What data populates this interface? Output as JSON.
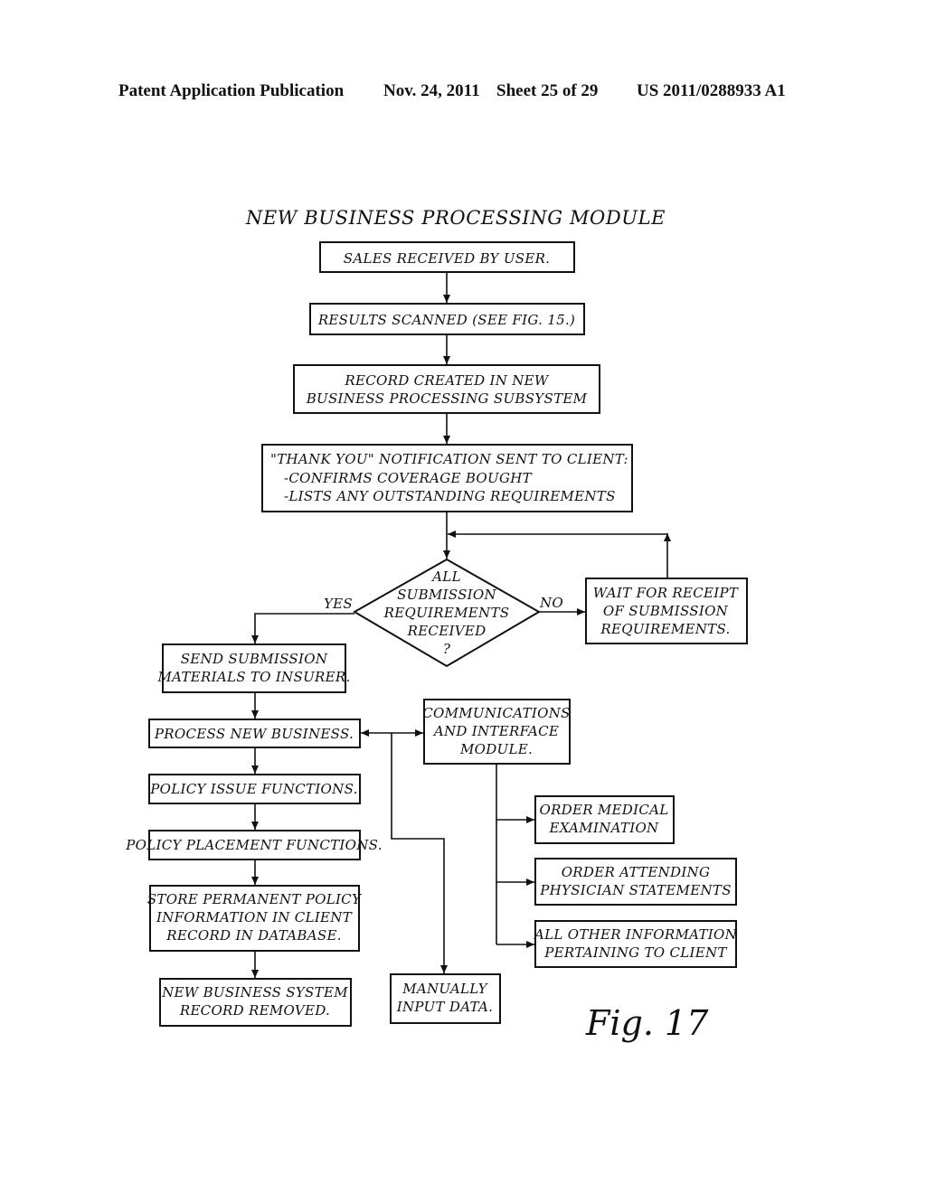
{
  "header": {
    "publication": "Patent Application Publication",
    "date": "Nov. 24, 2011",
    "sheet": "Sheet 25 of 29",
    "number": "US 2011/0288933 A1"
  },
  "diagram": {
    "title": "NEW BUSINESS PROCESSING MODULE",
    "figure_label": "Fig. 17",
    "nodes": {
      "sales": [
        "SALES RECEIVED BY USER."
      ],
      "scanned": [
        "RESULTS SCANNED (SEE FIG. 15.)"
      ],
      "record": [
        "RECORD CREATED IN NEW",
        "BUSINESS PROCESSING SUBSYSTEM"
      ],
      "thanks": [
        "\"THANK YOU\" NOTIFICATION SENT TO CLIENT:",
        "-CONFIRMS COVERAGE BOUGHT",
        "-LISTS ANY OUTSTANDING REQUIREMENTS"
      ],
      "decision": [
        "ALL",
        "SUBMISSION",
        "REQUIREMENTS",
        "RECEIVED",
        "?"
      ],
      "wait": [
        "WAIT FOR RECEIPT",
        "OF SUBMISSION",
        "REQUIREMENTS."
      ],
      "send": [
        "SEND SUBMISSION",
        "MATERIALS TO INSURER."
      ],
      "process": [
        "PROCESS NEW BUSINESS."
      ],
      "comms": [
        "COMMUNICATIONS",
        "AND INTERFACE",
        "MODULE."
      ],
      "issue": [
        "POLICY ISSUE FUNCTIONS."
      ],
      "placement": [
        "POLICY PLACEMENT FUNCTIONS."
      ],
      "store": [
        "STORE PERMANENT POLICY",
        "INFORMATION IN CLIENT",
        "RECORD IN DATABASE."
      ],
      "removed": [
        "NEW BUSINESS SYSTEM",
        "RECORD REMOVED."
      ],
      "manual": [
        "MANUALLY",
        "INPUT DATA."
      ],
      "medical": [
        "ORDER MEDICAL",
        "EXAMINATION"
      ],
      "physician": [
        "ORDER ATTENDING",
        "PHYSICIAN STATEMENTS"
      ],
      "other": [
        "ALL OTHER INFORMATION",
        "PERTAINING TO CLIENT"
      ]
    },
    "edge_labels": {
      "yes": "YES",
      "no": "NO"
    }
  }
}
